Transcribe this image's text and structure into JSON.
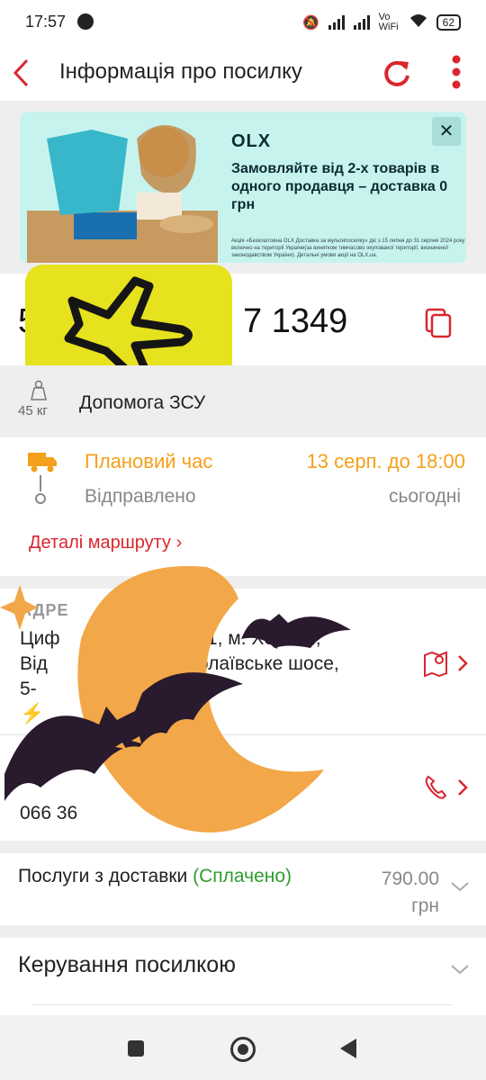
{
  "status_bar": {
    "time": "17:57",
    "network": "Vo WiFi",
    "battery": "62"
  },
  "header": {
    "title": "Інформація про посилку",
    "back_icon": "chevron-left-icon",
    "refresh_icon": "refresh-icon",
    "menu_icon": "more-vert-icon"
  },
  "banner": {
    "brand": "OLX",
    "headline": "Замовляйте від 2-х товарів в одного продавця – доставка 0 грн",
    "fine_print": "Акція «Безкоштовна OLX Доставка за мультипосилку» діє з 15 липня до 31 серпня 2024 року включно на території України(за винятком тимчасово окупованої території, визначеної законодавством України). Детальні умови акції на OLX.ua.",
    "close_label": "✕"
  },
  "parcel": {
    "tracking_number_start": "5",
    "tracking_number_end": "7 1349",
    "weight": "45 кг",
    "description": "Допомога ЗСУ"
  },
  "shipment_status": {
    "planned_label": "Плановий час",
    "planned_value": "13 серп. до 18:00",
    "sent_label": "Відправлено",
    "sent_value": "сьогодні",
    "route_link": "Деталі маршруту"
  },
  "address": {
    "heading": "АДРЕ",
    "line1": "Циф                           /1, м. Херсон,",
    "line2": "Від                           колаївське шосе,",
    "line3": "5-"
  },
  "recipient": {
    "phone": "066 36"
  },
  "services": {
    "label": "Послуги з доставки",
    "status": "(Сплачено)",
    "price": "790.00",
    "currency": "грн"
  },
  "management": {
    "label": "Керування посилкою"
  },
  "colors": {
    "accent": "#d9262e",
    "orange": "#f4a01a",
    "paid_green": "#2e9d2e",
    "sticker_yellow": "#e6e21e",
    "moon": "#f2a748",
    "bat": "#2a1a2e"
  }
}
